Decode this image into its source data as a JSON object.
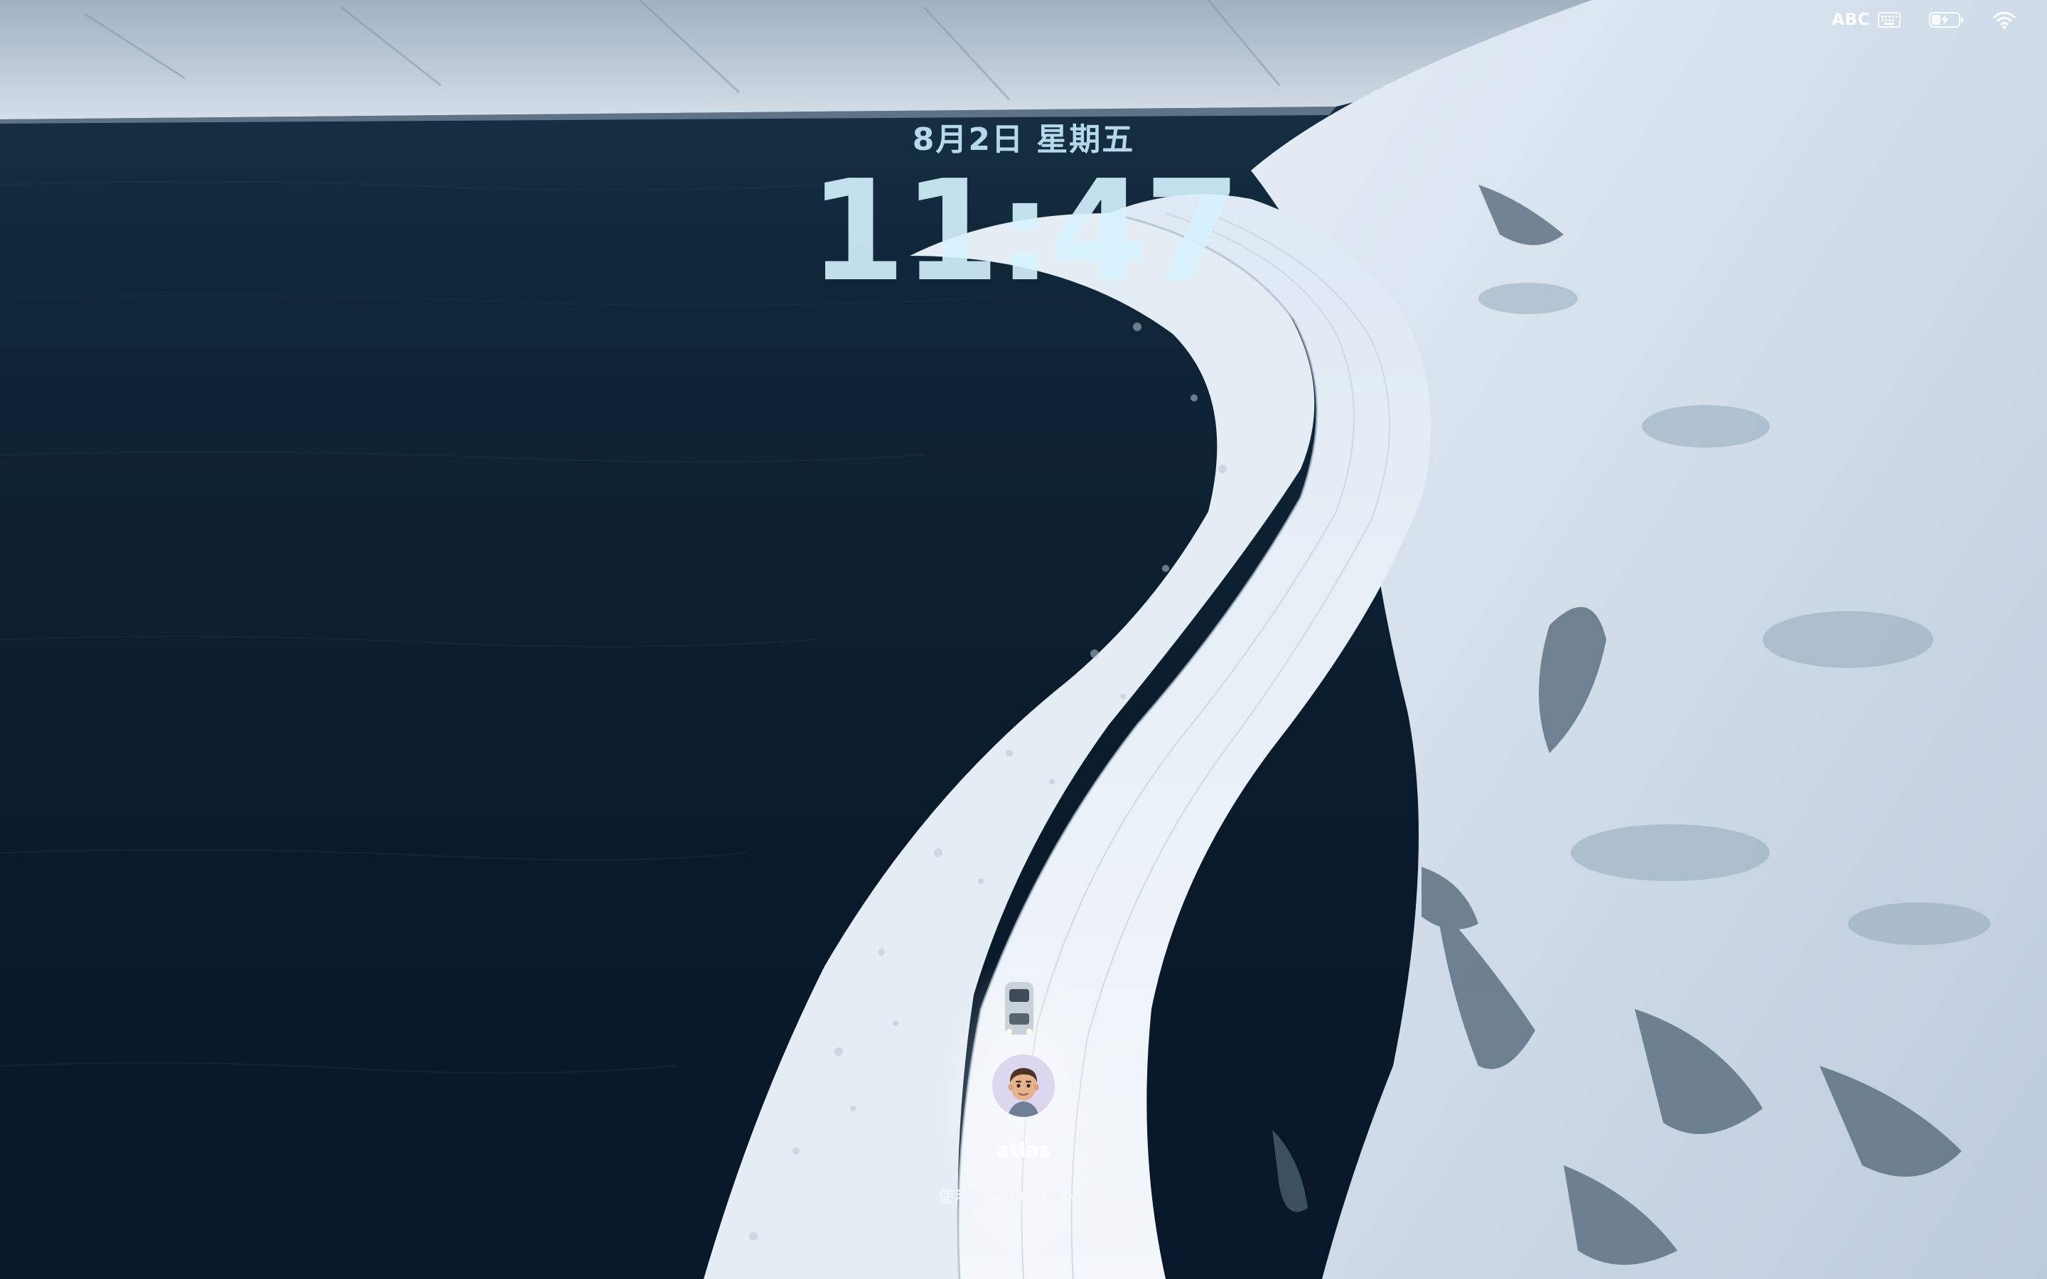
{
  "status_bar": {
    "input_source": "ABC",
    "keyboard_icon": "keyboard-icon",
    "battery_icon": "battery-charging-icon",
    "wifi_icon": "wifi-icon"
  },
  "lock_screen": {
    "date": "8月2日 星期五",
    "time": "11:47"
  },
  "user": {
    "name": "atlas",
    "avatar_icon": "memoji-avatar-icon",
    "hint": "使用触控 ID 或输入密码"
  },
  "colors": {
    "water": "#0b1d2c",
    "snow": "#e4ecf4",
    "clock": "#d6f3ff"
  }
}
